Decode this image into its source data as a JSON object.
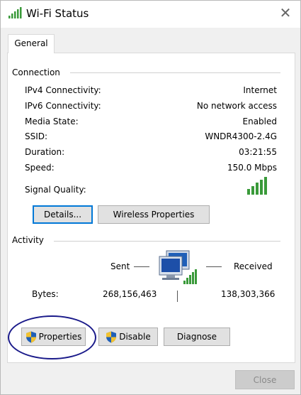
{
  "window": {
    "title": "Wi-Fi Status"
  },
  "tabs": [
    {
      "label": "General"
    }
  ],
  "connection": {
    "heading": "Connection",
    "rows": [
      {
        "label": "IPv4 Connectivity:",
        "value": "Internet"
      },
      {
        "label": "IPv6 Connectivity:",
        "value": "No network access"
      },
      {
        "label": "Media State:",
        "value": "Enabled"
      },
      {
        "label": "SSID:",
        "value": "WNDR4300-2.4G"
      },
      {
        "label": "Duration:",
        "value": "03:21:55"
      },
      {
        "label": "Speed:",
        "value": "150.0 Mbps"
      }
    ],
    "signal_label": "Signal Quality:",
    "signal_level": "5 of 5",
    "details_button": "Details...",
    "wireless_button": "Wireless Properties"
  },
  "activity": {
    "heading": "Activity",
    "sent_label": "Sent",
    "received_label": "Received",
    "bytes_label": "Bytes:",
    "bytes_sent": "268,156,463",
    "bytes_received": "138,303,366"
  },
  "actions": {
    "properties_button": "Properties",
    "disable_button": "Disable",
    "diagnose_button": "Diagnose"
  },
  "footer": {
    "close_button": "Close"
  },
  "colors": {
    "signal_green": "#3a9a3a",
    "focus_blue": "#0078d7",
    "annotation_oval": "#1a1a8a"
  }
}
